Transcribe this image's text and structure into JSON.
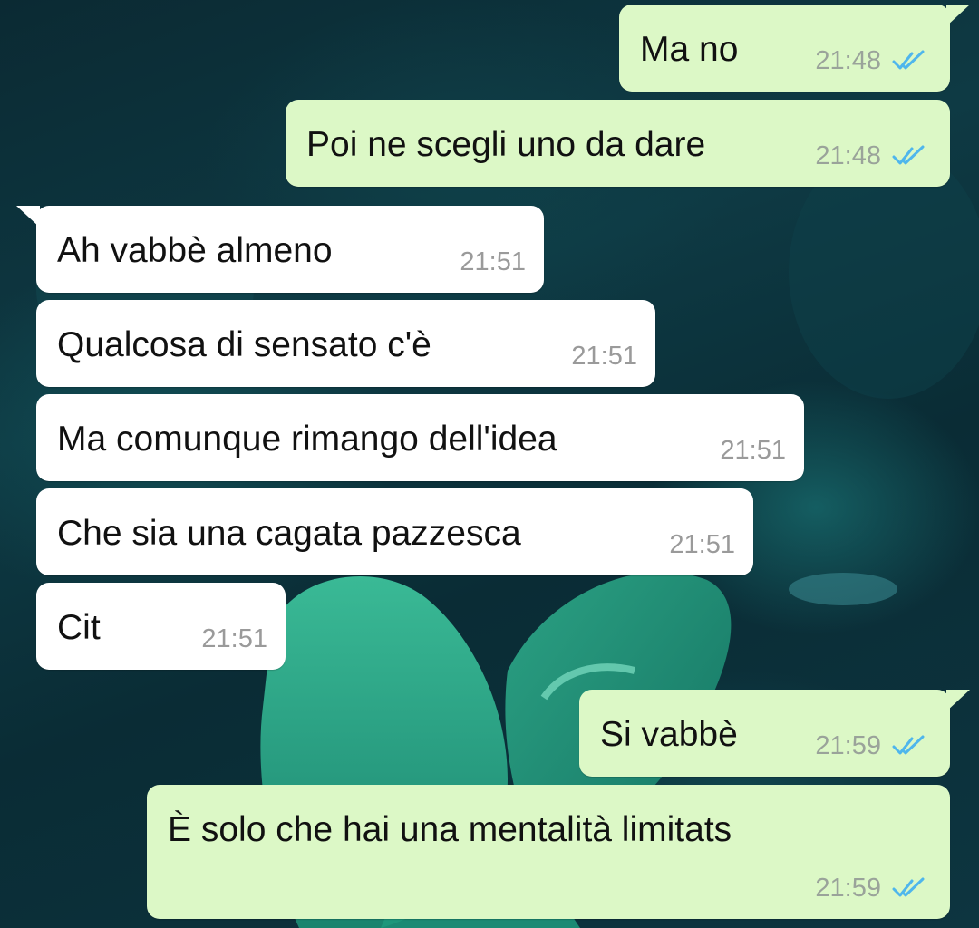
{
  "theme": {
    "outgoing_bubble": "#dcf8c6",
    "incoming_bubble": "#ffffff",
    "read_ticks": "#4fb6ec",
    "wallpaper": "#0e3a44"
  },
  "messages": [
    {
      "direction": "out",
      "text": "Ma no",
      "time": "21:48",
      "status": "read"
    },
    {
      "direction": "out",
      "text": "Poi ne scegli uno da dare",
      "time": "21:48",
      "status": "read"
    },
    {
      "direction": "in",
      "text": "Ah vabbè almeno",
      "time": "21:51"
    },
    {
      "direction": "in",
      "text": "Qualcosa di sensato c'è",
      "time": "21:51"
    },
    {
      "direction": "in",
      "text": "Ma comunque rimango dell'idea",
      "time": "21:51"
    },
    {
      "direction": "in",
      "text": "Che sia una cagata pazzesca",
      "time": "21:51"
    },
    {
      "direction": "in",
      "text": "Cit",
      "time": "21:51"
    },
    {
      "direction": "out",
      "text": "Si vabbè",
      "time": "21:59",
      "status": "read"
    },
    {
      "direction": "out",
      "text": "È solo che hai una mentalità limitats",
      "time": "21:59",
      "status": "read"
    }
  ]
}
